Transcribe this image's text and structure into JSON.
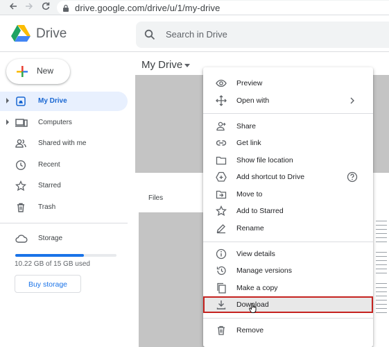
{
  "browser": {
    "url": "drive.google.com/drive/u/1/my-drive",
    "icons": [
      "back-arrow-icon",
      "forward-arrow-icon",
      "reload-icon",
      "lock-icon"
    ]
  },
  "header": {
    "brand": "Drive",
    "search_placeholder": "Search in Drive"
  },
  "sidebar": {
    "new_label": "New",
    "items": [
      {
        "label": "My Drive",
        "icon": "my-drive-icon",
        "active": true
      },
      {
        "label": "Computers",
        "icon": "computers-icon"
      },
      {
        "label": "Shared with me",
        "icon": "shared-icon"
      },
      {
        "label": "Recent",
        "icon": "clock-icon"
      },
      {
        "label": "Starred",
        "icon": "star-icon"
      },
      {
        "label": "Trash",
        "icon": "trash-icon"
      }
    ],
    "storage_label": "Storage",
    "storage_text": "10.22 GB of 15 GB used",
    "storage_used_fraction": 0.68,
    "buy_storage_label": "Buy storage"
  },
  "main": {
    "breadcrumb": "My Drive",
    "files_label": "Files"
  },
  "context_menu": {
    "items": [
      {
        "label": "Preview",
        "icon": "eye-icon"
      },
      {
        "label": "Open with",
        "icon": "move-arrows-icon",
        "submenu": true
      },
      {
        "label": "Share",
        "icon": "add-person-icon"
      },
      {
        "label": "Get link",
        "icon": "link-icon"
      },
      {
        "label": "Show file location",
        "icon": "folder-icon"
      },
      {
        "label": "Add shortcut to Drive",
        "icon": "add-shortcut-icon",
        "help": true
      },
      {
        "label": "Move to",
        "icon": "move-to-folder-icon"
      },
      {
        "label": "Add to Starred",
        "icon": "star-outline-icon"
      },
      {
        "label": "Rename",
        "icon": "pencil-icon"
      },
      {
        "label": "View details",
        "icon": "info-icon"
      },
      {
        "label": "Manage versions",
        "icon": "history-icon"
      },
      {
        "label": "Make a copy",
        "icon": "copy-icon"
      },
      {
        "label": "Download",
        "icon": "download-icon",
        "highlighted": true
      },
      {
        "label": "Remove",
        "icon": "trash-icon"
      }
    ]
  },
  "colors": {
    "accent": "#1a73e8",
    "active_bg": "#e8f0fe",
    "highlight_border": "#c5221f"
  }
}
